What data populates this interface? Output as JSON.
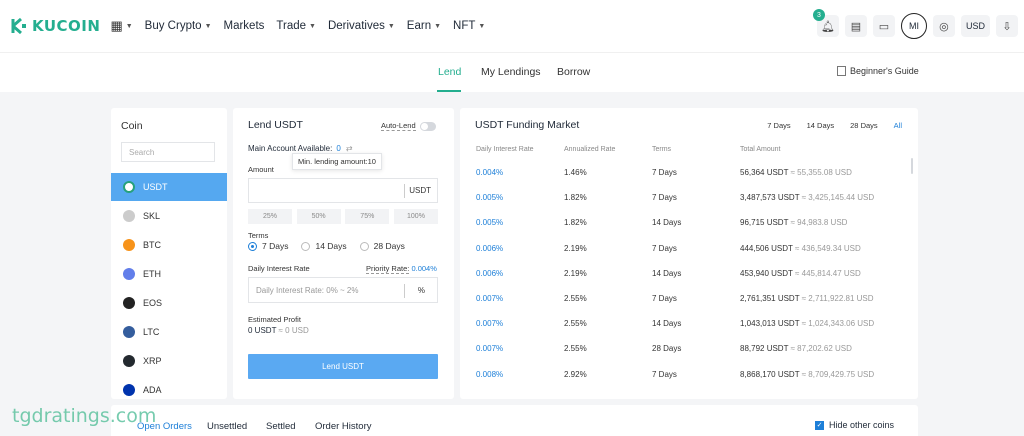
{
  "header": {
    "logo_text": "KUCOIN",
    "nav": [
      {
        "label": "Buy Crypto",
        "caret": true
      },
      {
        "label": "Markets",
        "caret": false
      },
      {
        "label": "Trade",
        "caret": true
      },
      {
        "label": "Derivatives",
        "caret": true
      },
      {
        "label": "Earn",
        "caret": true
      },
      {
        "label": "NFT",
        "caret": true
      }
    ],
    "notifications": "3",
    "avatar": "MI",
    "currency": "USD"
  },
  "subnav": {
    "tabs": [
      "Lend",
      "My Lendings",
      "Borrow"
    ],
    "guide": "Beginner's Guide"
  },
  "coin_panel": {
    "title": "Coin",
    "search_placeholder": "Search",
    "coins": [
      "USDT",
      "SKL",
      "BTC",
      "ETH",
      "EOS",
      "LTC",
      "XRP",
      "ADA"
    ],
    "coin_colors": [
      "#26a17b",
      "#cccccc",
      "#f7931a",
      "#627eea",
      "#222222",
      "#345d9d",
      "#23292f",
      "#0033ad"
    ]
  },
  "lend_panel": {
    "title": "Lend USDT",
    "auto_lend": "Auto-Lend",
    "available_label": "Main Account Available:",
    "available_value": "0",
    "tooltip": "Min. lending amount:10",
    "amount_label": "Amount",
    "amount_unit": "USDT",
    "percents": [
      "25%",
      "50%",
      "75%",
      "100%"
    ],
    "terms_label": "Terms",
    "terms": [
      "7 Days",
      "14 Days",
      "28 Days"
    ],
    "rate_label": "Daily Interest Rate",
    "priority_label": "Priority Rate:",
    "priority_value": "0.004%",
    "rate_placeholder": "Daily Interest Rate: 0% ~ 2%",
    "rate_unit": "%",
    "profit_label": "Estimated Profit",
    "profit_value": "0 USDT",
    "profit_approx": "≈ 0 USD",
    "lend_button": "Lend USDT"
  },
  "market": {
    "title": "USDT Funding Market",
    "filters": [
      "7 Days",
      "14 Days",
      "28 Days",
      "All"
    ],
    "columns": [
      "Daily Interest Rate",
      "Annualized Rate",
      "Terms",
      "Total Amount"
    ],
    "rows": [
      {
        "rate": "0.004%",
        "annual": "1.46%",
        "terms": "7 Days",
        "amount": "56,364 USDT",
        "approx": "≈ 55,355.08 USD"
      },
      {
        "rate": "0.005%",
        "annual": "1.82%",
        "terms": "7 Days",
        "amount": "3,487,573 USDT",
        "approx": "≈ 3,425,145.44 USD"
      },
      {
        "rate": "0.005%",
        "annual": "1.82%",
        "terms": "14 Days",
        "amount": "96,715 USDT",
        "approx": "≈ 94,983.8 USD"
      },
      {
        "rate": "0.006%",
        "annual": "2.19%",
        "terms": "7 Days",
        "amount": "444,506 USDT",
        "approx": "≈ 436,549.34 USD"
      },
      {
        "rate": "0.006%",
        "annual": "2.19%",
        "terms": "14 Days",
        "amount": "453,940 USDT",
        "approx": "≈ 445,814.47 USD"
      },
      {
        "rate": "0.007%",
        "annual": "2.55%",
        "terms": "7 Days",
        "amount": "2,761,351 USDT",
        "approx": "≈ 2,711,922.81 USD"
      },
      {
        "rate": "0.007%",
        "annual": "2.55%",
        "terms": "14 Days",
        "amount": "1,043,013 USDT",
        "approx": "≈ 1,024,343.06 USD"
      },
      {
        "rate": "0.007%",
        "annual": "2.55%",
        "terms": "28 Days",
        "amount": "88,792 USDT",
        "approx": "≈ 87,202.62 USD"
      },
      {
        "rate": "0.008%",
        "annual": "2.92%",
        "terms": "7 Days",
        "amount": "8,868,170 USDT",
        "approx": "≈ 8,709,429.75 USD"
      }
    ]
  },
  "orders": {
    "tabs": [
      "Open Orders",
      "Unsettled",
      "Settled",
      "Order History"
    ],
    "hide_other": "Hide other coins"
  },
  "watermark": "tgdratings.com",
  "colors": {
    "brand": "#24ae8f",
    "link": "#1d7fd8",
    "active_coin": "#55a8f0"
  }
}
